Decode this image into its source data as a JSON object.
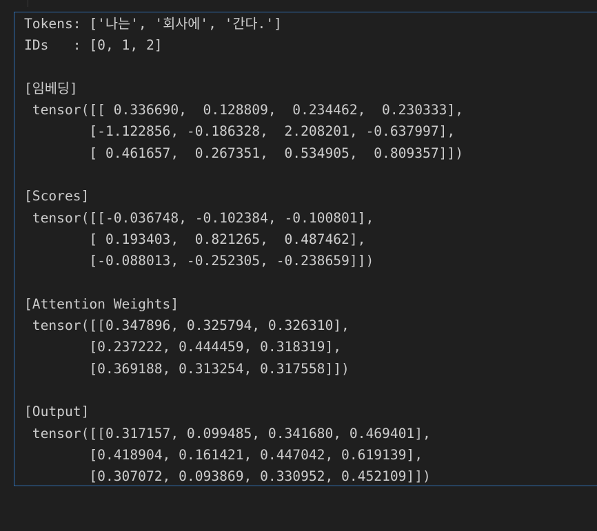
{
  "output": {
    "lines": [
      "Tokens: ['나는', '회사에', '간다.']",
      "IDs   : [0, 1, 2]",
      "",
      "[임베딩]",
      " tensor([[ 0.336690,  0.128809,  0.234462,  0.230333],",
      "        [-1.122856, -0.186328,  2.208201, -0.637997],",
      "        [ 0.461657,  0.267351,  0.534905,  0.809357]])",
      "",
      "[Scores]",
      " tensor([[-0.036748, -0.102384, -0.100801],",
      "        [ 0.193403,  0.821265,  0.487462],",
      "        [-0.088013, -0.252305, -0.238659]])",
      "",
      "[Attention Weights]",
      " tensor([[0.347896, 0.325794, 0.326310],",
      "        [0.237222, 0.444459, 0.318319],",
      "        [0.369188, 0.313254, 0.317558]])",
      "",
      "[Output]",
      " tensor([[0.317157, 0.099485, 0.341680, 0.469401],",
      "        [0.418904, 0.161421, 0.447042, 0.619139],",
      "        [0.307072, 0.093869, 0.330952, 0.452109]])"
    ]
  },
  "colors": {
    "background": "#1f1f1f",
    "text": "#cccccc",
    "cell_border": "#2f6fb2"
  }
}
